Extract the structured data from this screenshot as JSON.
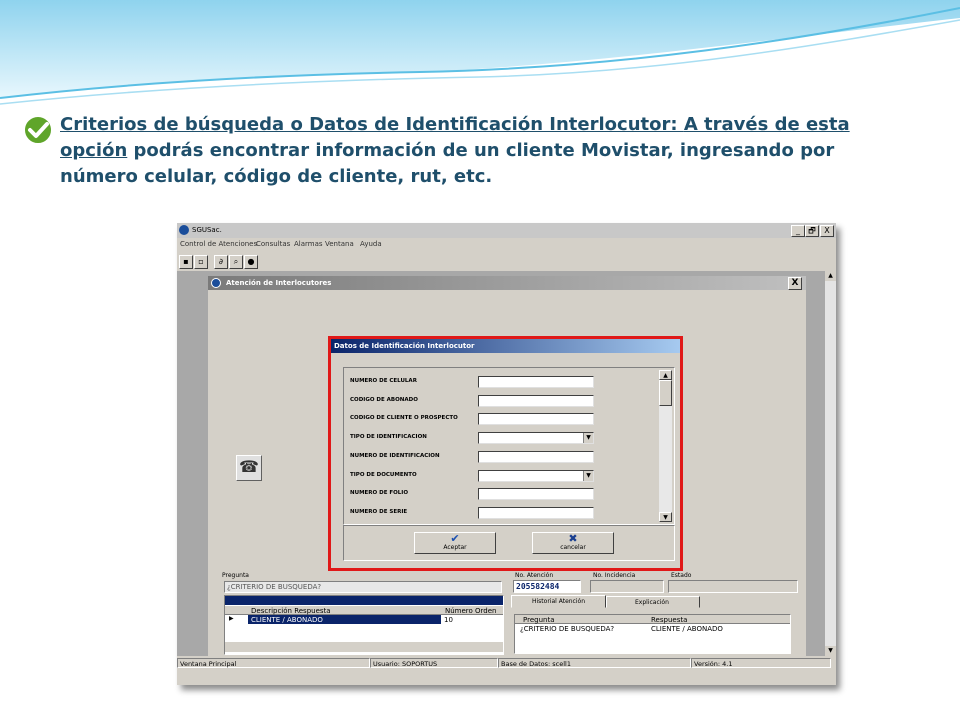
{
  "heading": {
    "bold_text": "Criterios de búsqueda o Datos  de Identificación Interlocutor: ",
    "body_first": "A través de esta opción",
    "body_rest": " podrás encontrar información de un cliente Movistar, ingresando por número celular, código de cliente, rut, etc."
  },
  "app": {
    "title": "SGUSac.",
    "window_buttons": [
      "_",
      "🗗",
      "X"
    ],
    "menu": [
      "Control de Atenciones",
      "Consultas",
      "Alarmas",
      "Ventana",
      "Ayuda"
    ]
  },
  "child_window": {
    "title": "Atención de Interlocutores",
    "close": "X"
  },
  "dialog": {
    "title": "Datos de Identificación Interlocutor",
    "fields": [
      {
        "label": "NUMERO DE CELULAR",
        "type": "text",
        "value": ""
      },
      {
        "label": "CODIGO DE ABONADO",
        "type": "text",
        "value": ""
      },
      {
        "label": "CODIGO DE CLIENTE O PROSPECTO",
        "type": "text",
        "value": ""
      },
      {
        "label": "TIPO DE IDENTIFICACION",
        "type": "select",
        "value": ""
      },
      {
        "label": "NUMERO DE IDENTIFICACION",
        "type": "text",
        "value": ""
      },
      {
        "label": "TIPO DE DOCUMENTO",
        "type": "select",
        "value": ""
      },
      {
        "label": "NUMERO DE FOLIO",
        "type": "text",
        "value": ""
      },
      {
        "label": "NUMERO DE SERIE",
        "type": "text",
        "value": ""
      }
    ],
    "accept_label": "Aceptar",
    "cancel_label": "cancelar"
  },
  "lower_panel": {
    "pregunta_label": "Pregunta",
    "pregunta_value": "¿CRITERIO DE BUSQUEDA?",
    "grid_headers": [
      "Descripción Respuesta",
      "Número Orden"
    ],
    "grid_row": [
      "CLIENTE / ABONADO",
      "10"
    ],
    "no_atencion_label": "No. Atención",
    "no_atencion_value": "205582484",
    "no_incidencia_label": "No. Incidencia",
    "estado_label": "Estado",
    "tabs": [
      "Historial Atención",
      "Explicación"
    ],
    "hist_headers": [
      "Pregunta",
      "Respuesta"
    ],
    "hist_row": [
      "¿CRITERIO DE BUSQUEDA?",
      "CLIENTE / ABONADO"
    ]
  },
  "status": {
    "ventana": "Ventana Principal",
    "usuario": "Usuario: SOPORTUS",
    "base": "Base de Datos: scell1",
    "version": "Versión: 4.1"
  },
  "colors": {
    "heading": "#1f4f6b",
    "highlight_border": "#e01818",
    "dialog_title": "#0a246a",
    "grid_selected": "#0a246a"
  }
}
